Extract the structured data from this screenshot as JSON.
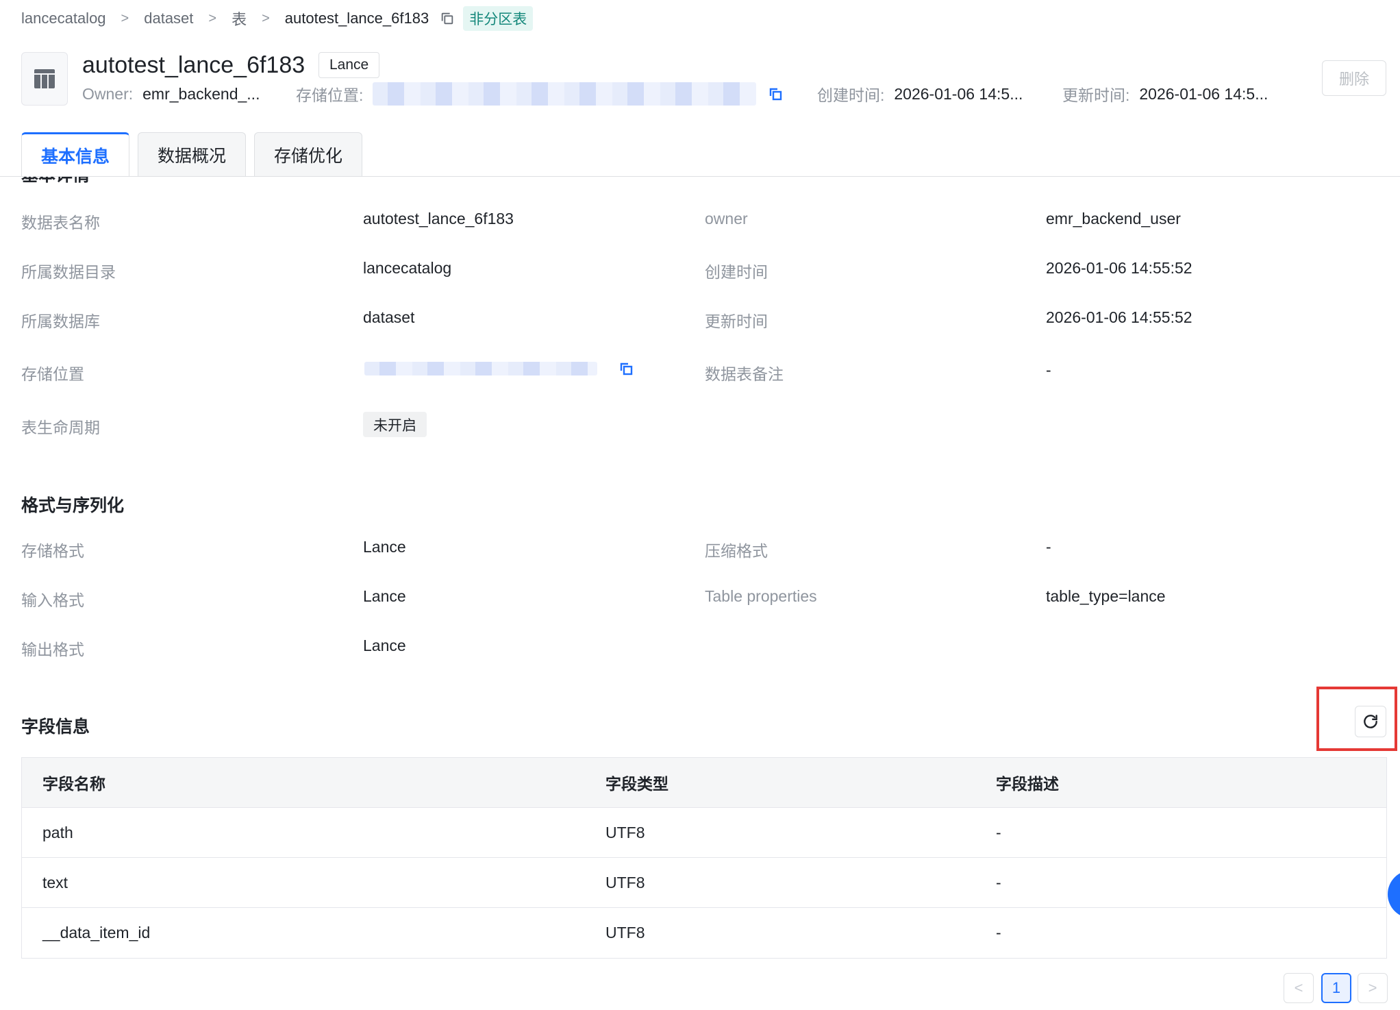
{
  "breadcrumb": {
    "items": [
      "lancecatalog",
      "dataset",
      "表",
      "autotest_lance_6f183"
    ],
    "separator": ">",
    "tag": "非分区表"
  },
  "header": {
    "title": "autotest_lance_6f183",
    "format_tag": "Lance",
    "owner_label": "Owner:",
    "owner_value": "emr_backend_...",
    "storage_label": "存储位置:",
    "created_label": "创建时间:",
    "created_value": "2026-01-06 14:5...",
    "updated_label": "更新时间:",
    "updated_value": "2026-01-06 14:5...",
    "delete_label": "删除"
  },
  "tabs": [
    {
      "label": "基本信息",
      "active": true
    },
    {
      "label": "数据概况",
      "active": false
    },
    {
      "label": "存储优化",
      "active": false
    }
  ],
  "basic": {
    "cut_title": "基本详情",
    "rows": [
      {
        "label": "数据表名称",
        "value": "autotest_lance_6f183",
        "label2": "owner",
        "value2": "emr_backend_user"
      },
      {
        "label": "所属数据目录",
        "value": "lancecatalog",
        "label2": "创建时间",
        "value2": "2026-01-06 14:55:52"
      },
      {
        "label": "所属数据库",
        "value": "dataset",
        "label2": "更新时间",
        "value2": "2026-01-06 14:55:52"
      },
      {
        "label": "存储位置",
        "label2": "数据表备注",
        "value2": "-"
      },
      {
        "label": "表生命周期",
        "value": "未开启"
      }
    ]
  },
  "format": {
    "title": "格式与序列化",
    "rows": [
      {
        "label": "存储格式",
        "value": "Lance",
        "label2": "压缩格式",
        "value2": "-"
      },
      {
        "label": "输入格式",
        "value": "Lance",
        "label2": "Table properties",
        "value2": "table_type=lance"
      },
      {
        "label": "输出格式",
        "value": "Lance"
      }
    ]
  },
  "fields": {
    "title": "字段信息",
    "columns": [
      "字段名称",
      "字段类型",
      "字段描述"
    ],
    "rows": [
      [
        "path",
        "UTF8",
        "-"
      ],
      [
        "text",
        "UTF8",
        "-"
      ],
      [
        "__data_item_id",
        "UTF8",
        "-"
      ]
    ]
  },
  "pagination": {
    "prev": "<",
    "page": "1",
    "next": ">"
  },
  "colors": {
    "accent": "#1e6fff",
    "highlight": "#e53935",
    "tag_green": "#13877a"
  }
}
